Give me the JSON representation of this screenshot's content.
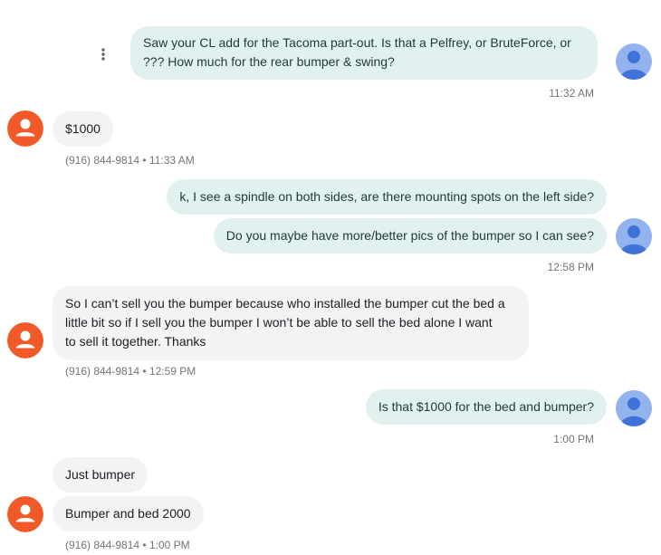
{
  "conversation": {
    "messages": [
      {
        "direction": "outgoing",
        "text": "Saw your CL add for the Tacoma part-out.  Is that a Pelfrey, or BruteForce, or\n???  How much for the rear bumper & swing?"
      },
      {
        "direction": "outgoing",
        "meta": "11:32 AM"
      },
      {
        "direction": "incoming",
        "text": "$1000"
      },
      {
        "direction": "incoming",
        "meta": "(916) 844-9814 • 11:33 AM"
      },
      {
        "direction": "outgoing",
        "text": "k, I see a spindle on both sides, are there mounting spots on the left side?"
      },
      {
        "direction": "outgoing",
        "text": "Do you maybe have more/better pics of the bumper so I can see?"
      },
      {
        "direction": "outgoing",
        "meta": "12:58 PM"
      },
      {
        "direction": "incoming",
        "text": "So I can’t sell you the bumper because who installed the bumper cut the bed a\nlittle bit so if I sell you the bumper I won’t be able to sell the bed alone I want\nto sell it together. Thanks"
      },
      {
        "direction": "incoming",
        "meta": "(916) 844-9814 • 12:59 PM"
      },
      {
        "direction": "outgoing",
        "text": "Is that $1000 for the bed and bumper?"
      },
      {
        "direction": "outgoing",
        "meta": "1:00 PM"
      },
      {
        "direction": "incoming",
        "text": "Just bumper"
      },
      {
        "direction": "incoming",
        "text": "Bumper and bed 2000"
      },
      {
        "direction": "incoming",
        "meta": "(916) 844-9814 • 1:00 PM"
      }
    ]
  },
  "icons": {
    "more_options": "more-vert-icon",
    "own_avatar": "person-icon",
    "contact_avatar": "person-icon"
  },
  "colors": {
    "outgoing_bubble": "#e1f1ef",
    "incoming_bubble": "#f1f3f4",
    "own_avatar_bg": "#93b3ee",
    "own_avatar_fg": "#3f73d8",
    "contact_avatar_bg": "#f15a28",
    "meta_text": "#70757a"
  }
}
